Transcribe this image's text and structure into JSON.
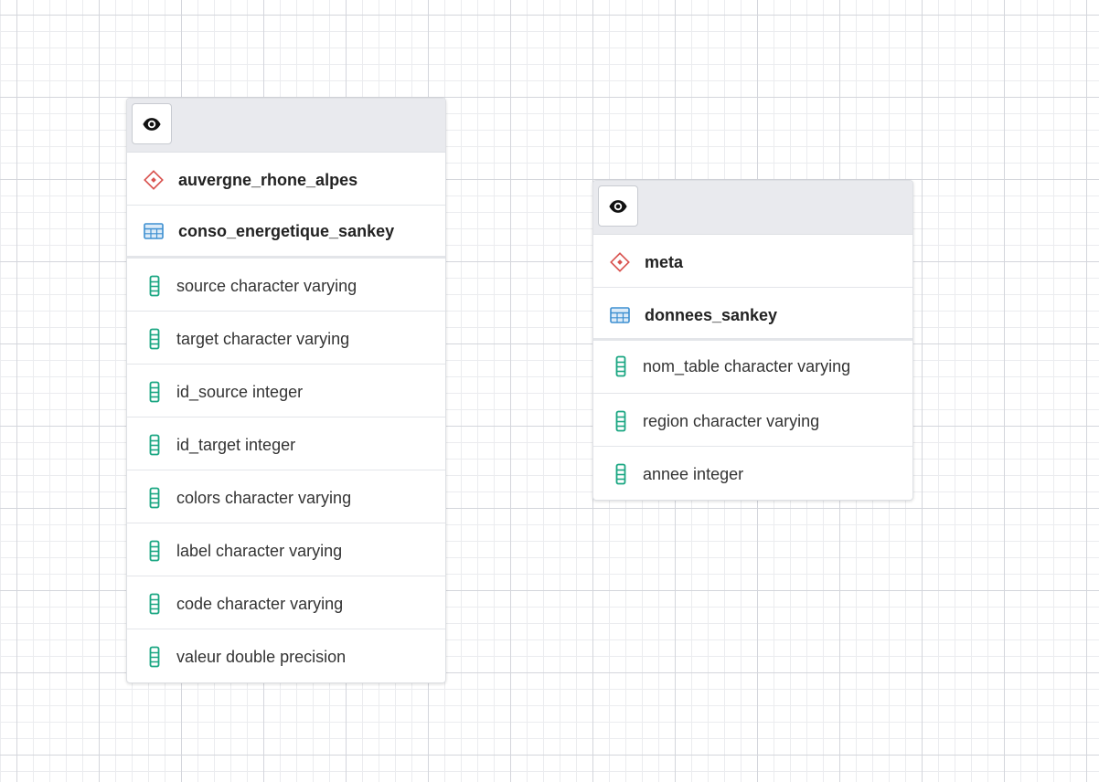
{
  "colors": {
    "schema_icon": "#d9534f",
    "table_icon": "#3d8fd1",
    "column_icon": "#1aa682",
    "header_bg": "#e9eaee"
  },
  "icons": {
    "visibility": "eye-icon",
    "schema": "schema-diamond-icon",
    "table": "table-grid-icon",
    "column": "column-icon"
  },
  "nodes": [
    {
      "schema": "auvergne_rhone_alpes",
      "table": "conso_energetique_sankey",
      "columns": [
        "source character varying",
        "target character varying",
        "id_source integer",
        "id_target integer",
        "colors character varying",
        "label character varying",
        "code character varying",
        "valeur double precision"
      ]
    },
    {
      "schema": "meta",
      "table": "donnees_sankey",
      "columns": [
        "nom_table character varying",
        "region character varying",
        "annee integer"
      ]
    }
  ]
}
